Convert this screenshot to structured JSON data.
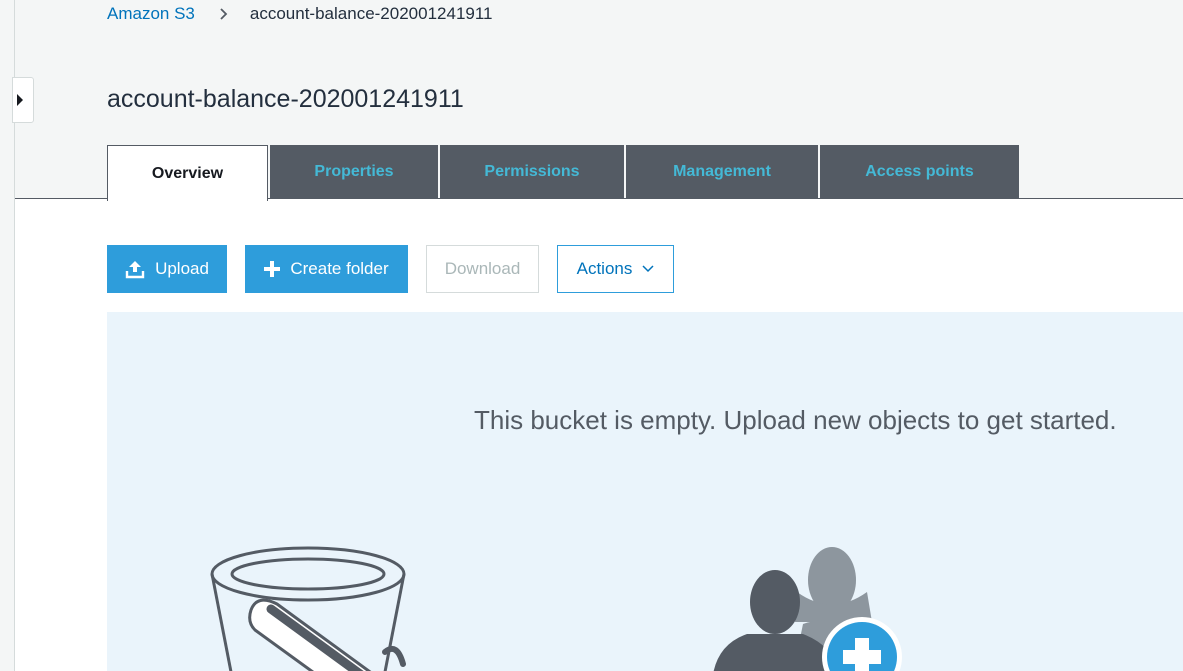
{
  "breadcrumb": {
    "root": "Amazon S3",
    "current": "account-balance-202001241911"
  },
  "page": {
    "title": "account-balance-202001241911"
  },
  "tabs": [
    {
      "label": "Overview",
      "active": true
    },
    {
      "label": "Properties",
      "active": false
    },
    {
      "label": "Permissions",
      "active": false
    },
    {
      "label": "Management",
      "active": false
    },
    {
      "label": "Access points",
      "active": false
    }
  ],
  "toolbar": {
    "upload_label": "Upload",
    "create_folder_label": "Create folder",
    "download_label": "Download",
    "actions_label": "Actions"
  },
  "empty_state": {
    "message": "This bucket is empty. Upload new objects to get started."
  },
  "icons": {
    "sidebar_toggle": "caret-right-icon",
    "breadcrumb_separator": "chevron-right-icon",
    "upload": "upload-icon",
    "create_folder": "plus-icon",
    "actions_dropdown": "chevron-down-icon"
  },
  "colors": {
    "accent": "#2e9ddb",
    "link": "#0073bb",
    "tab_background": "#545b64",
    "tab_text": "#44b9d6",
    "panel_background": "#eaf4fb"
  }
}
